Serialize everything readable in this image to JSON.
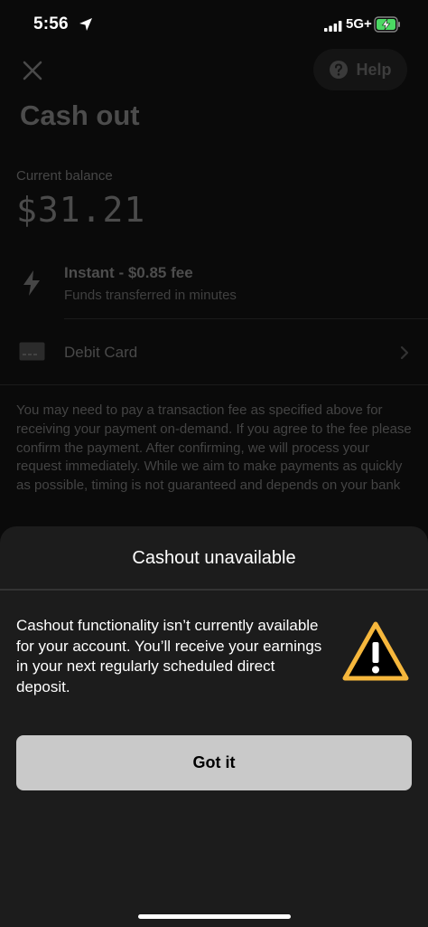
{
  "status_bar": {
    "time": "5:56",
    "network": "5G+"
  },
  "header": {
    "help_label": "Help",
    "title": "Cash out"
  },
  "balance": {
    "label": "Current balance",
    "value": "$31.21"
  },
  "transfer": {
    "title": "Instant - $0.85 fee",
    "subtitle": "Funds transferred in minutes"
  },
  "payment_method": {
    "label": "Debit Card"
  },
  "disclaimer": "You may need to pay a transaction fee as specified above for receiving your payment on-demand. If you agree to the fee please confirm the payment. After confirming, we will process your request immediately. While we aim to make payments as quickly as possible, timing is not guaranteed and depends on your bank",
  "sheet": {
    "title": "Cashout unavailable",
    "message": "Cashout functionality isn’t currently available for your account. You’ll receive your earnings in your next regularly scheduled direct deposit.",
    "button_label": "Got it"
  },
  "icons": {
    "close": "close-icon",
    "help": "help-icon",
    "bolt": "bolt-icon",
    "card": "card-icon",
    "chevron": "chevron-right-icon",
    "warning": "warning-icon"
  },
  "colors": {
    "warning": "#F6B73C",
    "button": "#C9C9C9",
    "sheet": "#1C1C1C",
    "battery": "#4CD964"
  }
}
